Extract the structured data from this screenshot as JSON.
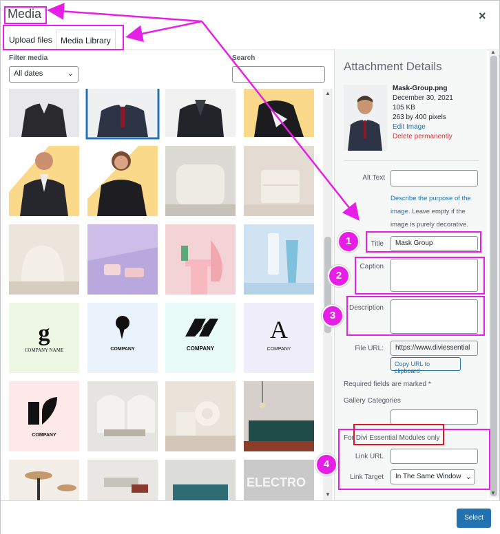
{
  "modal": {
    "title": "Media",
    "close_glyph": "×"
  },
  "tabs": {
    "upload": "Upload files",
    "library": "Media Library"
  },
  "filters": {
    "filter_label": "Filter media",
    "dates_value": "All dates",
    "search_label": "Search",
    "search_placeholder": ""
  },
  "grid": {
    "items": [
      {
        "kind": "portrait-female-dark"
      },
      {
        "kind": "portrait-male-suit-selected"
      },
      {
        "kind": "portrait-female-dark"
      },
      {
        "kind": "portrait-female-yellow"
      },
      {
        "kind": "portrait-male-yellow"
      },
      {
        "kind": "portrait-female-yellow"
      },
      {
        "kind": "pouf"
      },
      {
        "kind": "dresser"
      },
      {
        "kind": "armchair"
      },
      {
        "kind": "cosmetics-purple"
      },
      {
        "kind": "cosmetics-pink"
      },
      {
        "kind": "cosmetics-blue"
      },
      {
        "kind": "logo",
        "mark": "g",
        "company": "COMPANY NAME"
      },
      {
        "kind": "logo",
        "mark": "9",
        "company": "COMPANY"
      },
      {
        "kind": "logo",
        "mark": "N",
        "company": "COMPANY"
      },
      {
        "kind": "logo",
        "mark": "A",
        "company": "COMPANY"
      },
      {
        "kind": "logo",
        "mark": "K",
        "company": "COMPANY"
      },
      {
        "kind": "interior-arch"
      },
      {
        "kind": "interior-vase"
      },
      {
        "kind": "interior-lamp"
      },
      {
        "kind": "stool"
      },
      {
        "kind": "table"
      },
      {
        "kind": "interior-teal"
      },
      {
        "kind": "electro",
        "text": "ELECTRO"
      }
    ]
  },
  "details": {
    "heading": "Attachment Details",
    "file_name": "Mask-Group.png",
    "date": "December 30, 2021",
    "size": "105 KB",
    "dims": "263 by 400 pixels",
    "edit": "Edit Image",
    "delete": "Delete permanently",
    "alt_label": "Alt Text",
    "alt_value": "",
    "help_link": "Describe the purpose of the image",
    "help_rest": ". Leave empty if the image is purely decorative.",
    "title_label": "Title",
    "title_value": "Mask Group",
    "caption_label": "Caption",
    "caption_value": "",
    "description_label": "Description",
    "description_value": "",
    "url_label": "File URL:",
    "url_value": "https://www.diviessential",
    "copy_button": "Copy URL to clipboard",
    "required_note": "Required fields are marked *",
    "gallery_label": "Gallery Categories",
    "gallery_value": "",
    "divi_label": "For Divi Essential Modules only",
    "link_url_label": "Link URL",
    "link_url_value": "",
    "link_target_label": "Link Target",
    "link_target_value": "In The Same Window"
  },
  "footer": {
    "select_button": "Select"
  },
  "annotations": {
    "badge_1": "1",
    "badge_2": "2",
    "badge_3": "3",
    "badge_4": "4",
    "highlight_color": "#e61ee6",
    "red_box_color": "#e6141e"
  },
  "colors": {
    "accent": "#2271b1",
    "danger": "#d63638"
  }
}
